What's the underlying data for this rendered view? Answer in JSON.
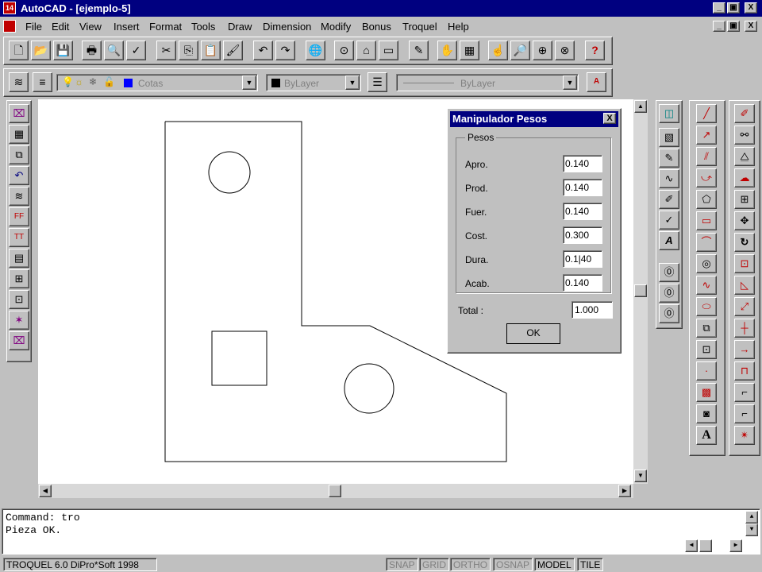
{
  "window": {
    "title": "AutoCAD - [ejemplo-5]",
    "app_icon_text": "14",
    "buttons": [
      "_",
      "▣",
      "X"
    ]
  },
  "menu": [
    {
      "label": "File",
      "key": "F"
    },
    {
      "label": "Edit",
      "key": "E"
    },
    {
      "label": "View",
      "key": "V"
    },
    {
      "label": "Insert",
      "key": "I"
    },
    {
      "label": "Format",
      "key": "o"
    },
    {
      "label": "Tools",
      "key": "T"
    },
    {
      "label": "Draw",
      "key": "D"
    },
    {
      "label": "Dimension",
      "key": "n"
    },
    {
      "label": "Modify",
      "key": "M"
    },
    {
      "label": "Bonus",
      "key": "B"
    },
    {
      "label": "Troquel",
      "key": "T"
    },
    {
      "label": "Help",
      "key": "H"
    }
  ],
  "layer_toolbar": {
    "layer_name": "Cotas",
    "color": "ByLayer",
    "linetype": "ByLayer"
  },
  "dialog": {
    "title": "Manipulador Pesos",
    "group_label": "Pesos",
    "fields": [
      {
        "label": "Apro.",
        "value": "0.140"
      },
      {
        "label": "Prod.",
        "value": "0.140"
      },
      {
        "label": "Fuer.",
        "value": "0.140"
      },
      {
        "label": "Cost.",
        "value": "0.300"
      },
      {
        "label": "Dura.",
        "value": "0.1|40"
      },
      {
        "label": "Acab.",
        "value": "0.140"
      }
    ],
    "total_label": "Total :",
    "total_value": "1.000",
    "ok_label": "OK"
  },
  "command": {
    "lines": [
      "Command: tro",
      "Pieza OK."
    ]
  },
  "status": {
    "product": "TROQUEL 6.0 DiPro*Soft 1998",
    "toggles": [
      "SNAP",
      "GRID",
      "ORTHO",
      "OSNAP",
      "MODEL",
      "TILE"
    ]
  },
  "colors": {
    "titlebar": "#000080",
    "face": "#c0c0c0",
    "canvas": "#ffffff"
  }
}
